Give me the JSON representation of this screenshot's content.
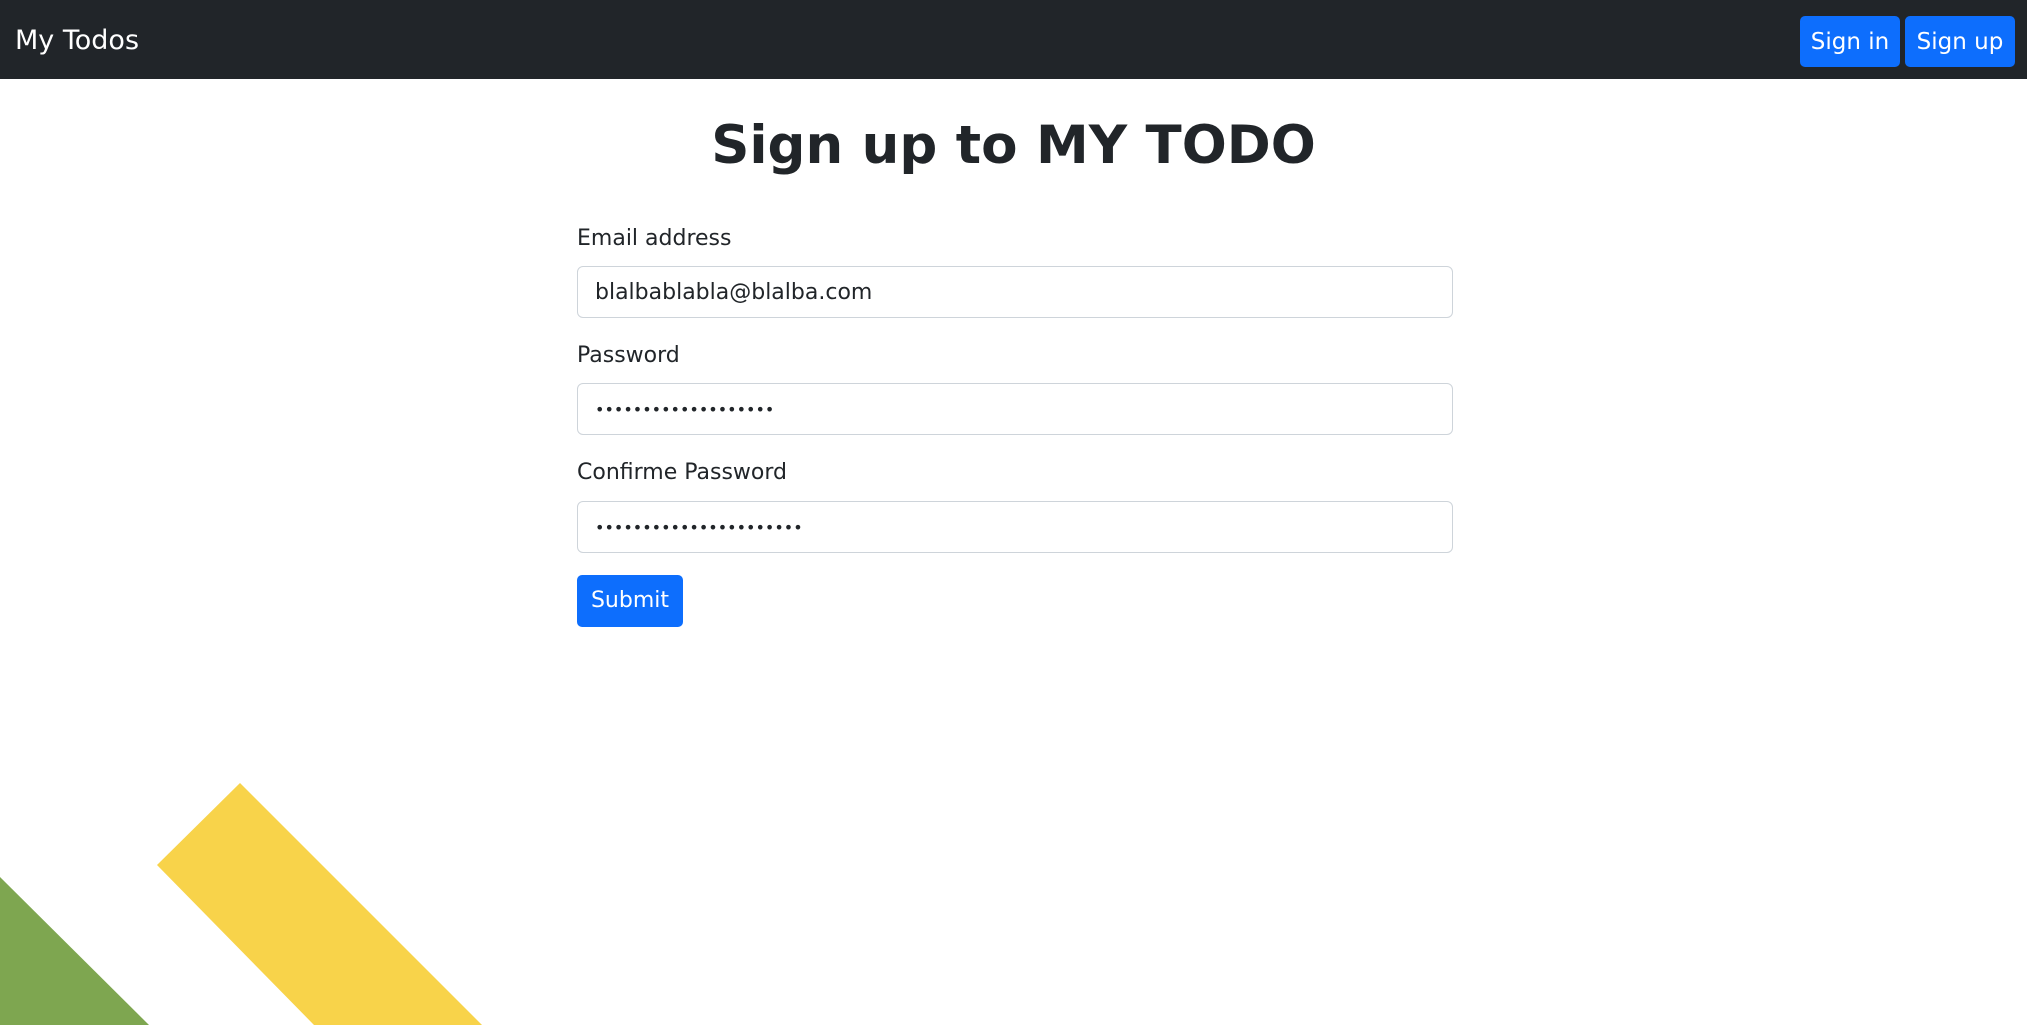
{
  "navbar": {
    "brand": "My Todos",
    "signin_label": "Sign in",
    "signup_label": "Sign up"
  },
  "title": "Sign up to MY TODO",
  "form": {
    "email_label": "Email address",
    "email_value": "blalbablabla@blalba.com",
    "password_label": "Password",
    "password_value": "1234567890123456789",
    "confirm_label": "Confirme Password",
    "confirm_value": "1234567890123456789012",
    "submit_label": "Submit"
  },
  "colors": {
    "navbar_bg": "#212529",
    "primary": "#0d6efd",
    "decor_green": "#7ea650",
    "decor_yellow": "#f8d34a"
  }
}
